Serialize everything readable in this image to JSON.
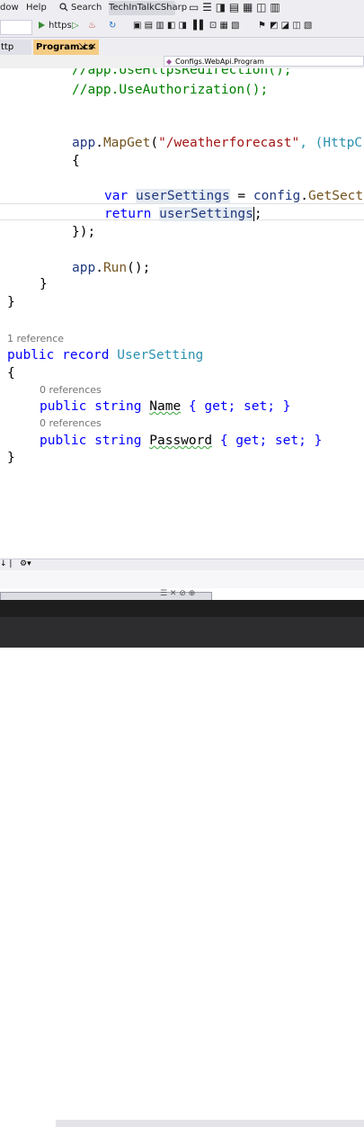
{
  "menu": {
    "window_partial": "dow",
    "help": "Help",
    "search": "Search",
    "app_title": "TechInTalkCSharp"
  },
  "toolbar": {
    "run_target": "https"
  },
  "tabs": [
    {
      "label": "ttp"
    },
    {
      "label": "Program.cs"
    }
  ],
  "navbar": {
    "scope": "Configs.WebApi.Program"
  },
  "code": {
    "line1": "//app.UseHttpsRedirection();",
    "line2": "//app.UseAuthorization();",
    "mapget_obj": "app",
    "mapget_method": "MapGet",
    "mapget_route": "\"/weatherforecast\"",
    "mapget_rest": ", (HttpC",
    "open_brace": "{",
    "var_kw": "var",
    "var_name": "userSettings",
    "var_rest_eq": " = ",
    "config_obj": "config",
    "config_method": "GetSect",
    "return_kw": "return",
    "return_val": "userSettings",
    "return_end": ";",
    "close_lambda": "});",
    "run_obj": "app",
    "run_method": "Run",
    "run_end": "();",
    "close_inner": "}",
    "close_outer": "}",
    "ref1": "1 reference",
    "record_public": "public",
    "record_kw": "record",
    "record_name": "UserSetting",
    "rec_open": "{",
    "ref0a": "0 references",
    "prop1_public": "public",
    "prop1_type": "string",
    "prop1_name": "Name",
    "prop1_acc": "{ get; set; }",
    "ref0b": "0 references",
    "prop2_public": "public",
    "prop2_type": "string",
    "prop2_name": "Password",
    "prop2_acc": "{ get; set; }",
    "rec_close": "}"
  },
  "icons": [
    "search-icon",
    "play-icon",
    "refresh-icon",
    "bookmark-icon",
    "dropdown-icon"
  ]
}
